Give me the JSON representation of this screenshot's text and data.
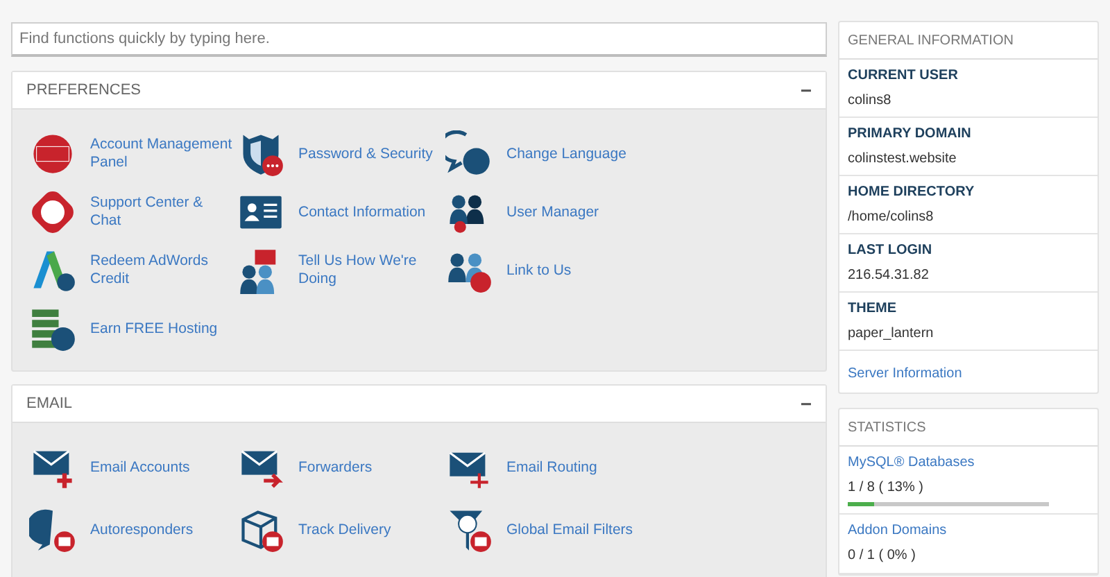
{
  "search": {
    "placeholder": "Find functions quickly by typing here."
  },
  "sections": [
    {
      "title": "PREFERENCES",
      "collapse": "−",
      "items": [
        {
          "label": "Account Management Panel"
        },
        {
          "label": "Password & Security"
        },
        {
          "label": "Change Language"
        },
        {
          "label": "Support Center & Chat"
        },
        {
          "label": "Contact Information"
        },
        {
          "label": "User Manager"
        },
        {
          "label": "Redeem AdWords Credit"
        },
        {
          "label": "Tell Us How We're Doing"
        },
        {
          "label": "Link to Us"
        },
        {
          "label": "Earn FREE Hosting"
        }
      ]
    },
    {
      "title": "EMAIL",
      "collapse": "−",
      "items": [
        {
          "label": "Email Accounts"
        },
        {
          "label": "Forwarders"
        },
        {
          "label": "Email Routing"
        },
        {
          "label": "Autoresponders"
        },
        {
          "label": "Track Delivery"
        },
        {
          "label": "Global Email Filters"
        }
      ]
    }
  ],
  "general_information": {
    "title": "GENERAL INFORMATION",
    "fields": [
      {
        "label": "CURRENT USER",
        "value": "colins8"
      },
      {
        "label": "PRIMARY DOMAIN",
        "value": "colinstest.website"
      },
      {
        "label": "HOME DIRECTORY",
        "value": "/home/colins8"
      },
      {
        "label": "LAST LOGIN",
        "value": "216.54.31.82"
      },
      {
        "label": "THEME",
        "value": "paper_lantern"
      }
    ],
    "link": "Server Information"
  },
  "statistics": {
    "title": "STATISTICS",
    "items": [
      {
        "label": "MySQL® Databases",
        "reading": "1 / 8 ( 13% )",
        "level": 0.13
      },
      {
        "label": "Addon Domains",
        "reading": "0 / 1 ( 0% )"
      }
    ]
  }
}
